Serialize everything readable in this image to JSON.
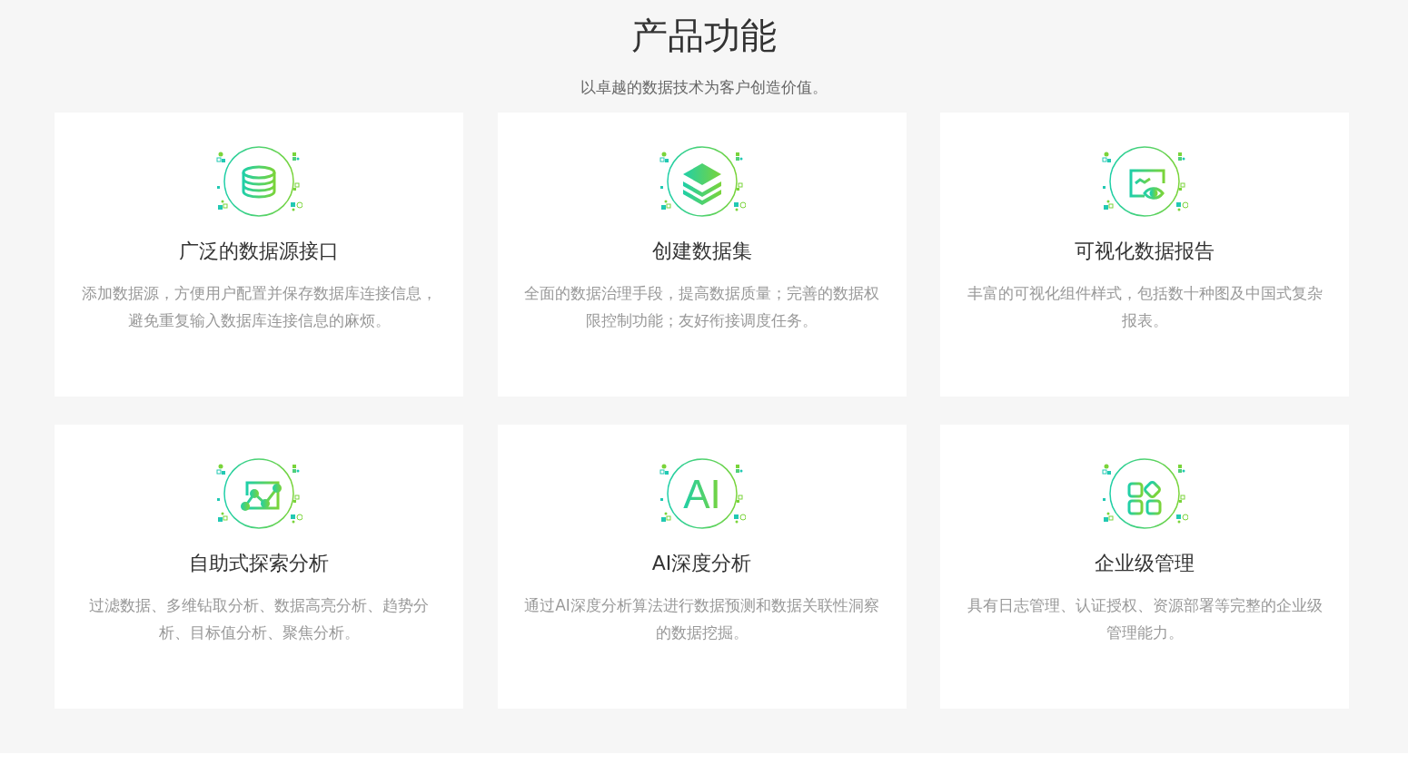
{
  "heading": "产品功能",
  "subtitle": "以卓越的数据技术为客户创造价值。",
  "features": [
    {
      "kind": "database",
      "title": "广泛的数据源接口",
      "description": "添加数据源，方便用户配置并保存数据库连接信息，避免重复输入数据库连接信息的麻烦。"
    },
    {
      "kind": "layers",
      "title": "创建数据集",
      "description": "全面的数据治理手段，提高数据质量；完善的数据权限控制功能；友好衔接调度任务。"
    },
    {
      "kind": "report",
      "title": "可视化数据报告",
      "description": "丰富的可视化组件样式，包括数十种图及中国式复杂报表。"
    },
    {
      "kind": "chart",
      "title": "自助式探索分析",
      "description": "过滤数据、多维钻取分析、数据高亮分析、趋势分析、目标值分析、聚焦分析。"
    },
    {
      "kind": "ai",
      "icon_text": "AI",
      "title": "AI深度分析",
      "description": "通过AI深度分析算法进行数据预测和数据关联性洞察的数据挖掘。"
    },
    {
      "kind": "apps",
      "title": "企业级管理",
      "description": "具有日志管理、认证授权、资源部署等完整的企业级管理能力。"
    }
  ]
}
